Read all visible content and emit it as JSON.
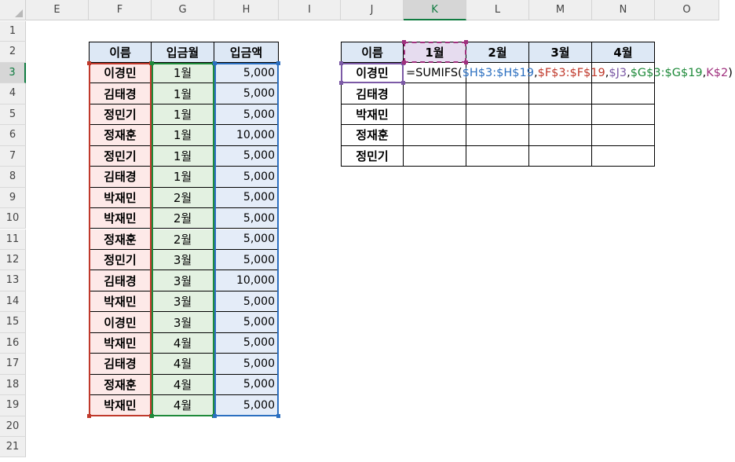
{
  "columns": [
    "E",
    "F",
    "G",
    "H",
    "I",
    "J",
    "K",
    "L",
    "M",
    "N",
    "O"
  ],
  "rows": [
    "1",
    "2",
    "3",
    "4",
    "5",
    "6",
    "7",
    "8",
    "9",
    "10",
    "11",
    "12",
    "13",
    "14",
    "15",
    "16",
    "17",
    "18",
    "19",
    "20",
    "21"
  ],
  "source_table": {
    "headers": [
      "이름",
      "입금월",
      "입금액"
    ],
    "rows": [
      [
        "이경민",
        "1월",
        "5,000"
      ],
      [
        "김태경",
        "1월",
        "5,000"
      ],
      [
        "정민기",
        "1월",
        "5,000"
      ],
      [
        "정재훈",
        "1월",
        "10,000"
      ],
      [
        "정민기",
        "1월",
        "5,000"
      ],
      [
        "김태경",
        "1월",
        "5,000"
      ],
      [
        "박재민",
        "2월",
        "5,000"
      ],
      [
        "박재민",
        "2월",
        "5,000"
      ],
      [
        "정재훈",
        "2월",
        "5,000"
      ],
      [
        "정민기",
        "3월",
        "5,000"
      ],
      [
        "김태경",
        "3월",
        "10,000"
      ],
      [
        "박재민",
        "3월",
        "5,000"
      ],
      [
        "이경민",
        "3월",
        "5,000"
      ],
      [
        "박재민",
        "4월",
        "5,000"
      ],
      [
        "김태경",
        "4월",
        "5,000"
      ],
      [
        "정재훈",
        "4월",
        "5,000"
      ],
      [
        "박재민",
        "4월",
        "5,000"
      ]
    ]
  },
  "summary_table": {
    "header_name": "이름",
    "months": [
      "1월",
      "2월",
      "3월",
      "4월"
    ],
    "names": [
      "이경민",
      "김태경",
      "박재민",
      "정재훈",
      "정민기"
    ]
  },
  "formula": {
    "prefix": "=SUMIFS(",
    "arg_sum_range": "$H$3:$H$19",
    "arg_criteria_range1": "$F$3:$F$19",
    "arg_criteria1": "$J3",
    "arg_criteria_range2": "$G$3:$G$19",
    "arg_criteria2": "K$2",
    "suffix": ")",
    "sep": ","
  },
  "colors": {
    "range_h": "#2b6fc0",
    "range_f": "#c0392b",
    "ref_j": "#7c5aa6",
    "range_g": "#1e8a3a",
    "ref_k": "#a0307e",
    "selection": "#107c41"
  }
}
